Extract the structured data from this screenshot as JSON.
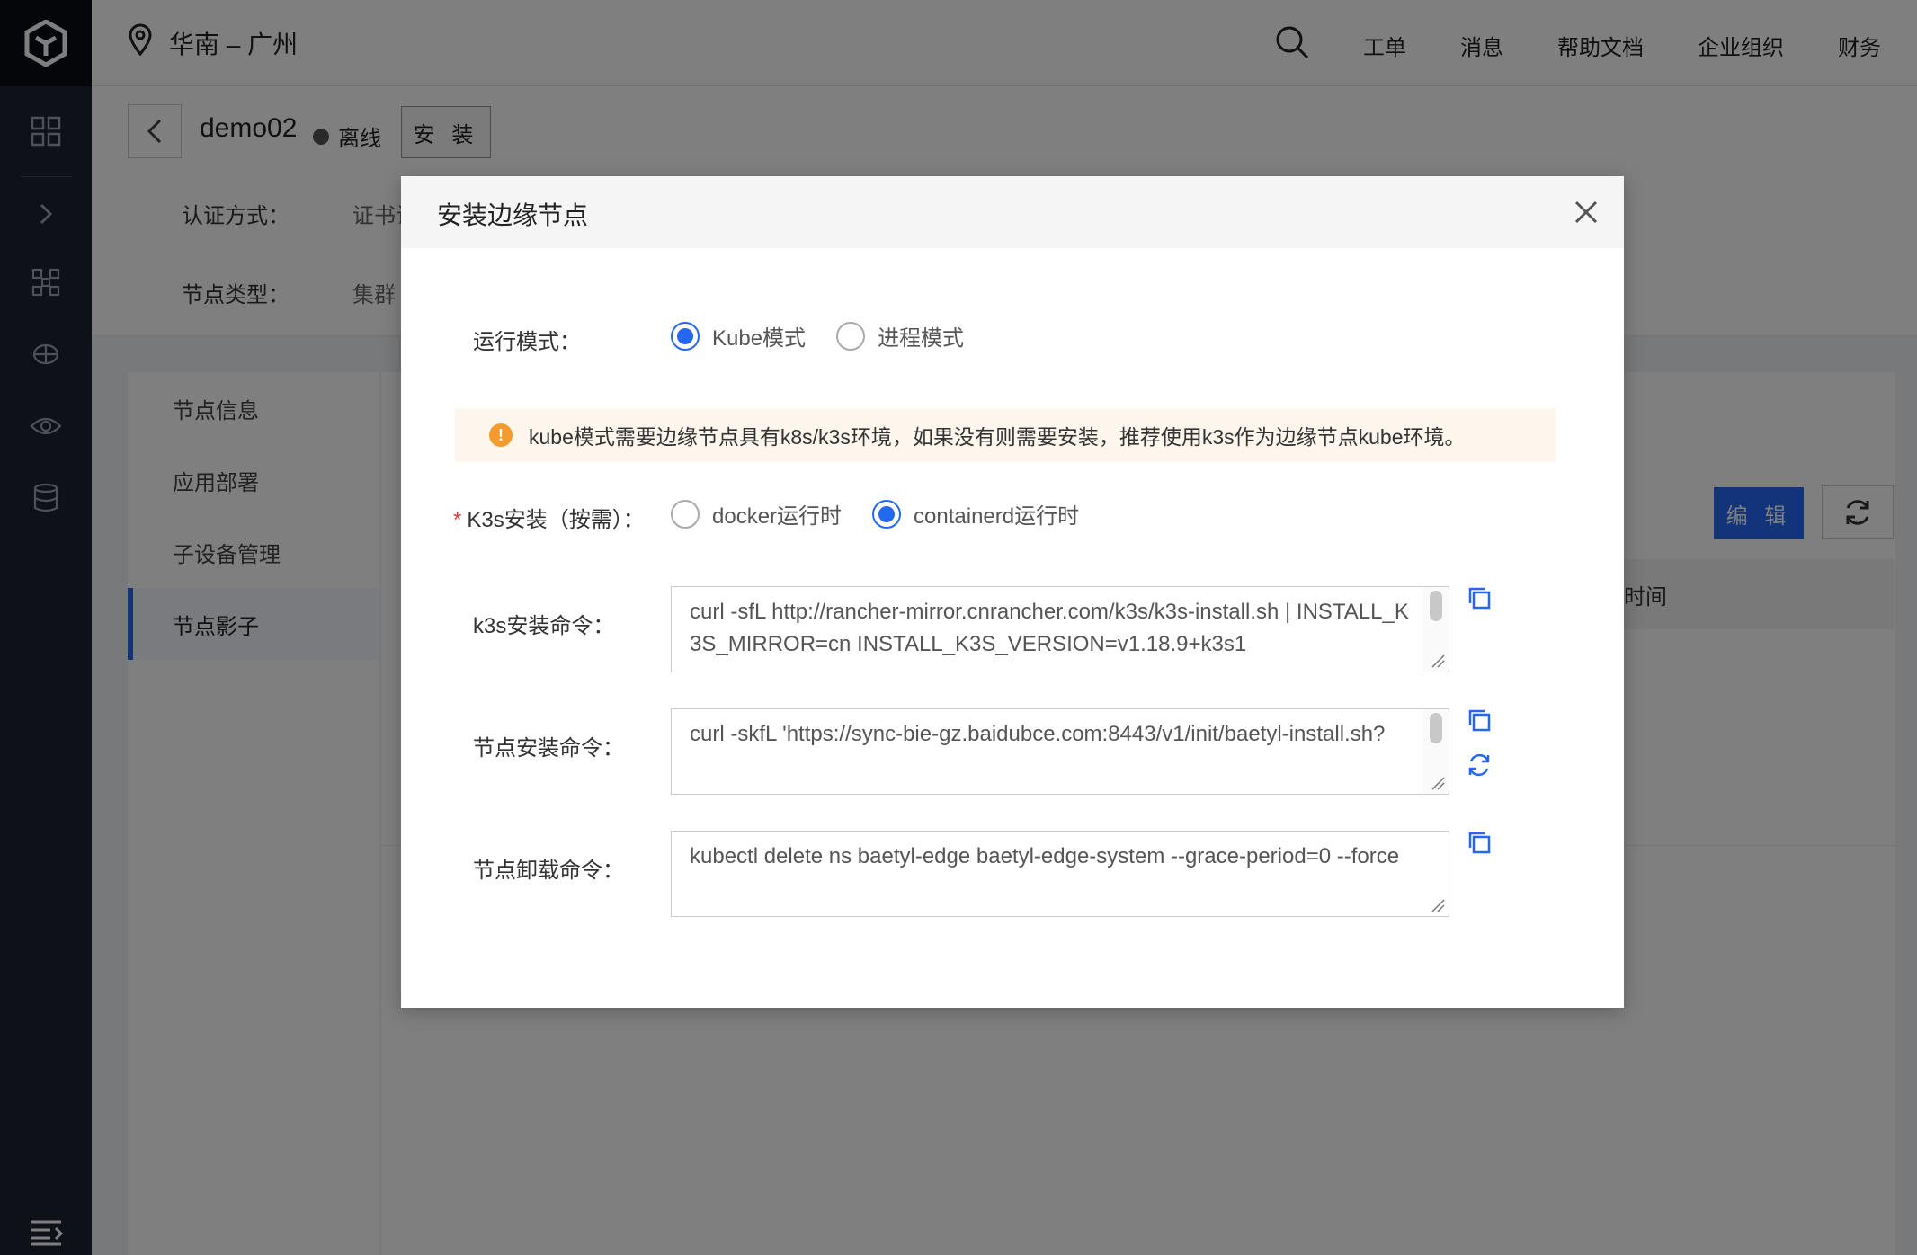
{
  "topbar": {
    "region": "华南 – 广州",
    "nav": [
      "工单",
      "消息",
      "帮助文档",
      "企业组织",
      "财务"
    ]
  },
  "header": {
    "node_name": "demo02",
    "status": "离线",
    "install_label": "安 装",
    "auth_label": "认证方式：",
    "auth_value": "证书认",
    "type_label": "节点类型：",
    "type_value": "集群"
  },
  "side_menu": {
    "items": [
      "节点信息",
      "应用部署",
      "子设备管理",
      "节点影子"
    ],
    "active": "节点影子"
  },
  "main": {
    "edit_label": "编 辑",
    "table_col": "时间"
  },
  "modal": {
    "title": "安装边缘节点",
    "run_mode": {
      "label": "运行模式：",
      "options": [
        "Kube模式",
        "进程模式"
      ],
      "selected": "Kube模式"
    },
    "alert": "kube模式需要边缘节点具有k8s/k3s环境，如果没有则需要安装，推荐使用k3s作为边缘节点kube环境。",
    "k3s_install": {
      "required_mark": "*",
      "label": "K3s安装（按需）：",
      "options": [
        "docker运行时",
        "containerd运行时"
      ],
      "selected": "containerd运行时"
    },
    "k3s_cmd": {
      "label": "k3s安装命令：",
      "value": "curl -sfL http://rancher-mirror.cnrancher.com/k3s/k3s-install.sh | INSTALL_K3S_MIRROR=cn INSTALL_K3S_VERSION=v1.18.9+k3s1"
    },
    "node_install_cmd": {
      "label": "节点安装命令：",
      "value": "curl -skfL 'https://sync-bie-gz.baidubce.com:8443/v1/init/baetyl-install.sh?"
    },
    "node_uninstall_cmd": {
      "label": "节点卸载命令：",
      "value": "kubectl delete ns baetyl-edge baetyl-edge-system --grace-period=0 --force"
    }
  },
  "icons": {
    "logo": "cube-logo-icon",
    "location": "map-pin-icon",
    "search": "search-icon",
    "copy": "copy-icon",
    "refresh": "refresh-icon",
    "close": "close-icon"
  },
  "colors": {
    "primary": "#2468f2",
    "warning": "#f39b2c",
    "required": "#e23c39"
  }
}
